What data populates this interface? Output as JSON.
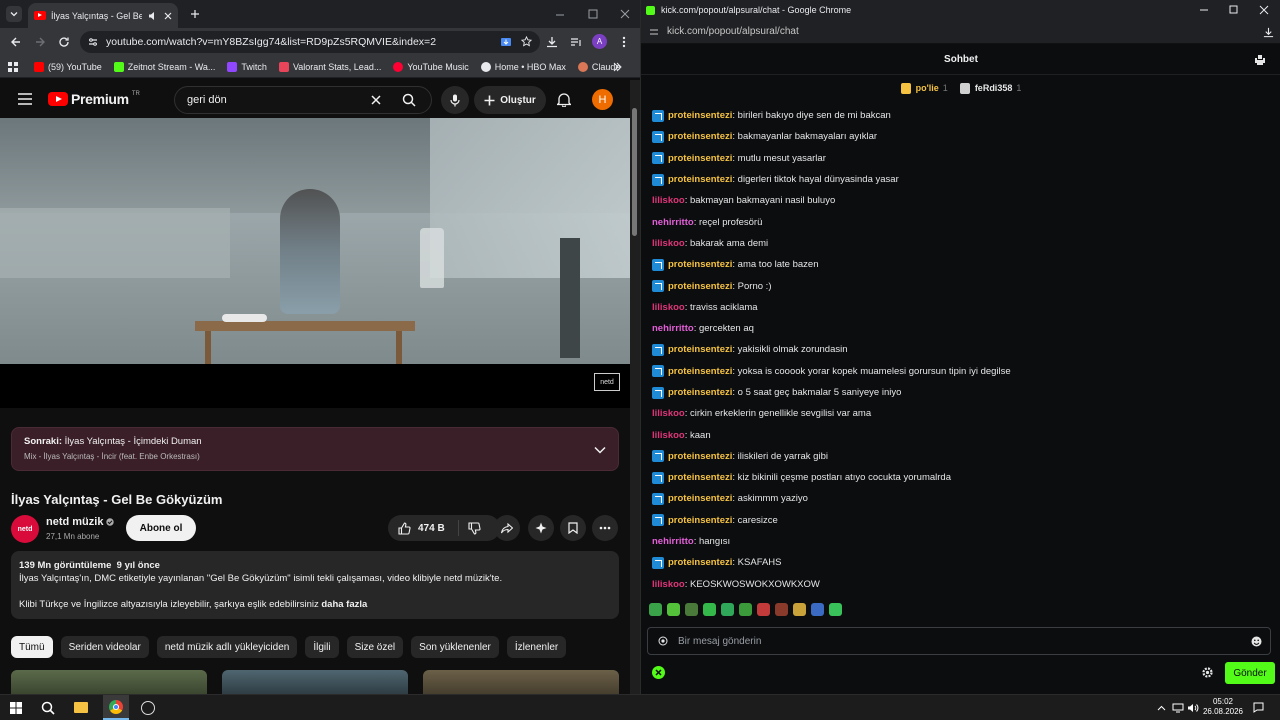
{
  "left_window": {
    "tab": {
      "title": "İlyas Yalçıntaş - Gel Be Gökyü"
    },
    "url": "youtube.com/watch?v=mY8BZsIgg74&list=RD9pZs5RQMVIE&index=2",
    "bookmarks": [
      {
        "label": "(59) YouTube",
        "color": "#ff0000"
      },
      {
        "label": "Zeitnot Stream - Wa...",
        "color": "#53fc18"
      },
      {
        "label": "Twitch",
        "color": "#9146ff"
      },
      {
        "label": "Valorant Stats, Lead...",
        "color": "#e8445a"
      },
      {
        "label": "YouTube Music",
        "color": "#ff0033"
      },
      {
        "label": "Home • HBO Max",
        "color": "#ffffff"
      },
      {
        "label": "Claude",
        "color": "#d97757"
      }
    ],
    "avatar_letter": "A"
  },
  "youtube": {
    "logo": "Premium",
    "logo_region": "TR",
    "search_value": "geri dön",
    "create_label": "Oluştur",
    "user_initial": "H",
    "watermark": "netd",
    "upnext": {
      "prefix": "Sonraki:",
      "title": "İlyas Yalçıntaş - İçimdeki Duman",
      "subtitle": "Mix - İlyas Yalçıntaş - İncir (feat. Enbe Orkestrası)"
    },
    "video_title": "İlyas Yalçıntaş - Gel Be Gökyüzüm",
    "channel": {
      "name": "netd müzik",
      "subs": "27,1 Mn abone",
      "subscribe": "Abone ol",
      "logo_text": "netd"
    },
    "likes": "474 B",
    "description": {
      "stats": "139 Mn görüntüleme  9 yıl önce",
      "line1": "İlyas Yalçıntaş'ın, DMC etiketiyle yayınlanan \"Gel Be Gökyüzüm\" isimli tekli çalışaması, video klibiyle netd müzik'te.",
      "line2": "Klibi Türkçe ve İngilizce altyazısıyla izleyebilir, şarkıya eşlik edebilirsiniz",
      "more": "daha fazla"
    },
    "chips": [
      "Tümü",
      "Seriden videolar",
      "netd müzik adlı yükleyiciden",
      "İlgili",
      "Size özel",
      "Son yüklenenler",
      "İzlenenler"
    ]
  },
  "right_window": {
    "title": "kick.com/popout/alpsural/chat - Google Chrome",
    "url": "kick.com/popout/alpsural/chat",
    "chat_title": "Sohbet",
    "pinned": [
      {
        "name": "po'lie",
        "count": "1"
      },
      {
        "name": "feRdi358",
        "count": "1"
      }
    ],
    "messages": [
      {
        "user": "proteinsentezi",
        "badge": true,
        "color": "#f5c242",
        "text": ": birileri bakıyo diye sen de mi bakcan"
      },
      {
        "user": "proteinsentezi",
        "badge": true,
        "color": "#f5c242",
        "text": ": bakmayanlar bakmayaları ayıklar"
      },
      {
        "user": "proteinsentezi",
        "badge": true,
        "color": "#f5c242",
        "text": ": mutlu mesut yasarlar"
      },
      {
        "user": "proteinsentezi",
        "badge": true,
        "color": "#f5c242",
        "text": ": digerleri tiktok hayal dünyasinda yasar"
      },
      {
        "user": "liliskoo",
        "badge": false,
        "color": "#e0357a",
        "text": ": bakmayan bakmayani nasil buluyo"
      },
      {
        "user": "nehirritto",
        "badge": false,
        "color": "#e45fd8",
        "text": ": reçel profesörü"
      },
      {
        "user": "liliskoo",
        "badge": false,
        "color": "#e0357a",
        "text": ": bakarak ama demi"
      },
      {
        "user": "proteinsentezi",
        "badge": true,
        "color": "#f5c242",
        "text": ": ama too late bazen"
      },
      {
        "user": "proteinsentezi",
        "badge": true,
        "color": "#f5c242",
        "text": ": Porno :)"
      },
      {
        "user": "liliskoo",
        "badge": false,
        "color": "#e0357a",
        "text": ": traviss aciklama"
      },
      {
        "user": "nehirritto",
        "badge": false,
        "color": "#e45fd8",
        "text": ": gercekten aq"
      },
      {
        "user": "proteinsentezi",
        "badge": true,
        "color": "#f5c242",
        "text": ": yakisikli olmak zorundasin"
      },
      {
        "user": "proteinsentezi",
        "badge": true,
        "color": "#f5c242",
        "text": ": yoksa is cooook yorar kopek muamelesi gorursun tipin iyi degilse"
      },
      {
        "user": "proteinsentezi",
        "badge": true,
        "color": "#f5c242",
        "text": ": o 5 saat geç bakmalar 5 saniyeye iniyo"
      },
      {
        "user": "liliskoo",
        "badge": false,
        "color": "#e0357a",
        "text": ": cirkin erkeklerin genellikle sevgilisi var ama"
      },
      {
        "user": "liliskoo",
        "badge": false,
        "color": "#e0357a",
        "text": ": kaan"
      },
      {
        "user": "proteinsentezi",
        "badge": true,
        "color": "#f5c242",
        "text": ": iliskileri de yarrak gibi"
      },
      {
        "user": "proteinsentezi",
        "badge": true,
        "color": "#f5c242",
        "text": ": kiz bikinili çeşme postları atıyo cocukta yorumalrda"
      },
      {
        "user": "proteinsentezi",
        "badge": true,
        "color": "#f5c242",
        "text": ": askimmm yaziyo"
      },
      {
        "user": "proteinsentezi",
        "badge": true,
        "color": "#f5c242",
        "text": ": caresizce"
      },
      {
        "user": "nehirritto",
        "badge": false,
        "color": "#e45fd8",
        "text": ": hangısı"
      },
      {
        "user": "proteinsentezi",
        "badge": true,
        "color": "#f5c242",
        "text": ": KSAFAHS"
      },
      {
        "user": "liliskoo",
        "badge": false,
        "color": "#e0357a",
        "text": ": KEOSKWOSWOKXOWKXOW"
      }
    ],
    "input_placeholder": "Bir mesaj gönderin",
    "send_label": "Gönder"
  },
  "taskbar": {
    "time": "05:02",
    "date": "26.08.2026"
  }
}
